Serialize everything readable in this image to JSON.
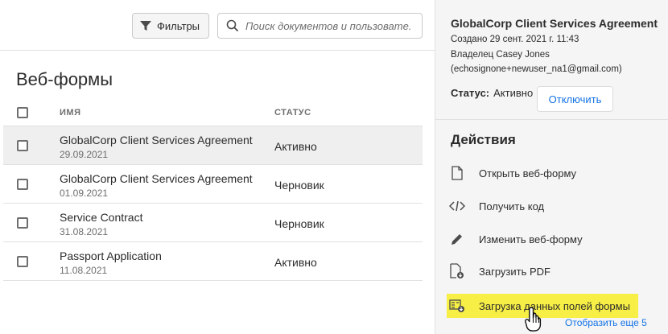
{
  "toolbar": {
    "filter_label": "Фильтры",
    "search_placeholder": "Поиск документов и пользовате..."
  },
  "page_title": "Веб-формы",
  "table": {
    "columns": [
      "ИМЯ",
      "СТАТУС"
    ],
    "rows": [
      {
        "name": "GlobalCorp Client Services Agreement",
        "date": "29.09.2021",
        "status": "Активно",
        "selected": true
      },
      {
        "name": "GlobalCorp Client Services Agreement",
        "date": "01.09.2021",
        "status": "Черновик",
        "selected": false
      },
      {
        "name": "Service Contract",
        "date": "31.08.2021",
        "status": "Черновик",
        "selected": false
      },
      {
        "name": "Passport Application",
        "date": "11.08.2021",
        "status": "Активно",
        "selected": false
      }
    ]
  },
  "panel": {
    "title": "GlobalCorp Client Services Agreement",
    "created": "Создано 29 сент. 2021 г. 11:43",
    "owner": "Владелец Casey Jones",
    "email": "(echosignone+newuser_na1@gmail.com)",
    "status_label": "Статус:",
    "status_value": "Активно",
    "disable_button": "Отключить",
    "actions_title": "Действия",
    "actions": [
      {
        "label": "Открыть веб-форму",
        "icon": "document-icon"
      },
      {
        "label": "Получить код",
        "icon": "code-icon"
      },
      {
        "label": "Изменить веб-форму",
        "icon": "pencil-icon"
      },
      {
        "label": "Загрузить PDF",
        "icon": "pdf-download-icon"
      },
      {
        "label": "Загрузка данных полей формы",
        "icon": "data-download-icon"
      }
    ],
    "show_more": "Отобразить еще 5"
  },
  "colors": {
    "accent": "#1473e6",
    "highlight": "#f7ef45",
    "selected_row": "#efefef",
    "panel_bg": "#f5f5f5"
  }
}
